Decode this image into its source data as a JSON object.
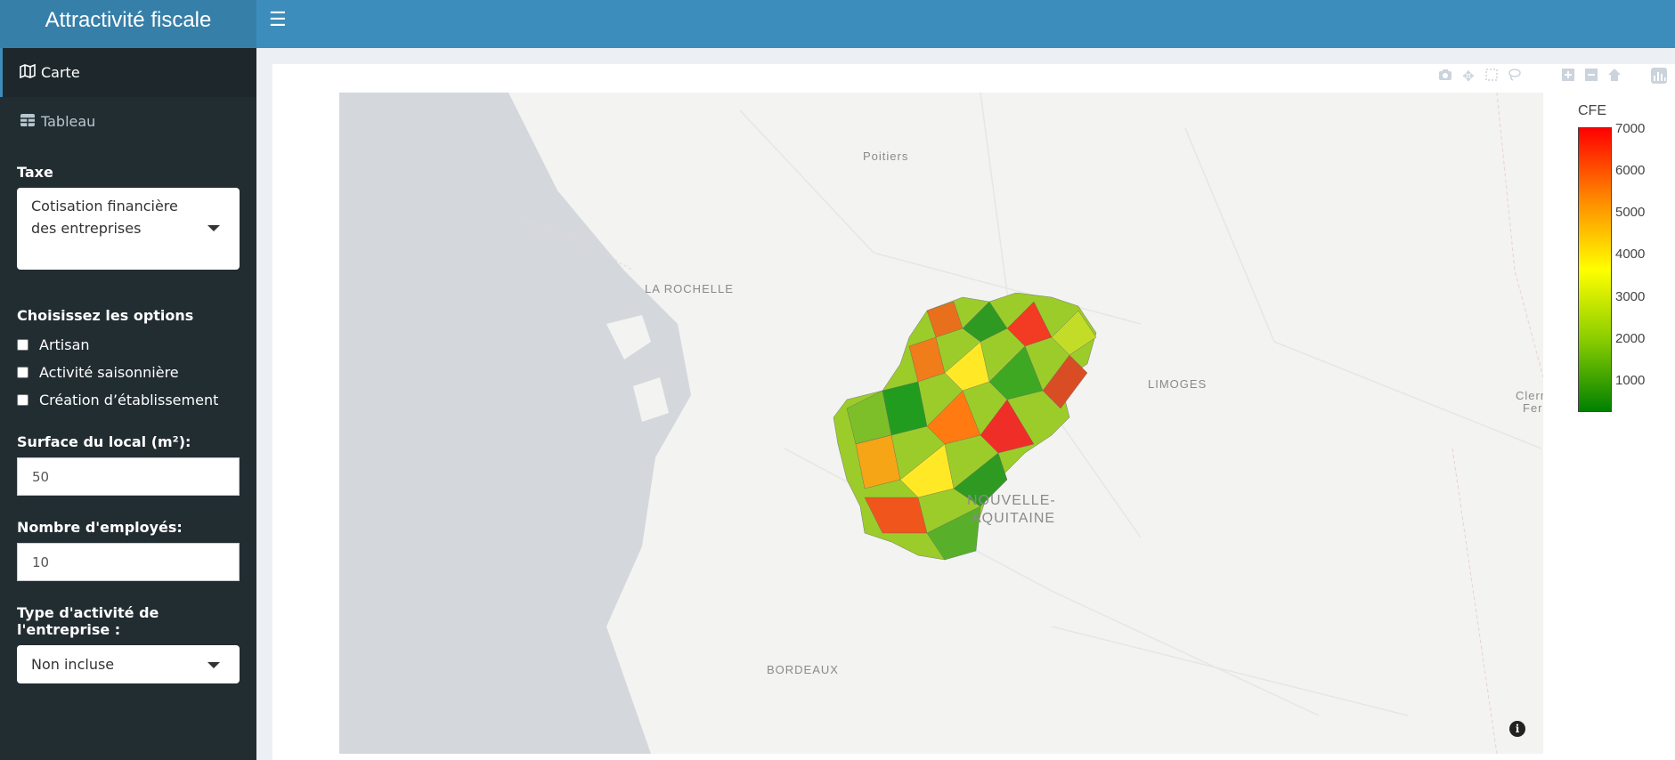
{
  "app": {
    "title": "Attractivité fiscale"
  },
  "menu": [
    {
      "label": "Carte",
      "icon": "map-icon",
      "active": true
    },
    {
      "label": "Tableau",
      "icon": "table-icon",
      "active": false
    }
  ],
  "form": {
    "taxe_label": "Taxe",
    "taxe_value": "Cotisation financière des entreprises",
    "options_label": "Choisissez les options",
    "options": [
      {
        "label": "Artisan",
        "checked": false
      },
      {
        "label": "Activité saisonnière",
        "checked": false
      },
      {
        "label": "Création d’établissement",
        "checked": false
      }
    ],
    "surface_label": "Surface du local (m²):",
    "surface_value": "50",
    "employes_label": "Nombre d'employés:",
    "employes_value": "10",
    "activite_label": "Type d'activité de l'entreprise :",
    "activite_value": "Non incluse"
  },
  "map": {
    "labels": [
      "Poitiers",
      "LA ROCHELLE",
      "LIMOGES",
      "NOUVELLE-",
      "AQUITAINE",
      "BORDEAUX",
      "Clerm",
      "Fer"
    ],
    "colorbar_title": "CFE",
    "colorbar_ticks": [
      "7000",
      "6000",
      "5000",
      "4000",
      "3000",
      "2000",
      "1000"
    ],
    "colors": {
      "high": "#ff0000",
      "mid": "#ffff00",
      "low": "#008000"
    }
  },
  "modebar": [
    "camera-icon",
    "pan-icon",
    "box-select-icon",
    "lasso-icon",
    "zoom-in-icon",
    "zoom-out-icon",
    "home-icon",
    "plotly-logo-icon"
  ]
}
